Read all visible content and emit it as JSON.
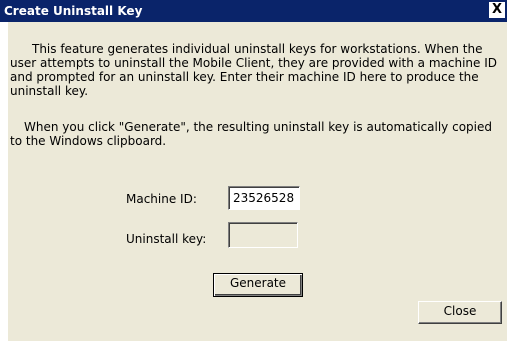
{
  "window": {
    "title": "Create Uninstall Key",
    "close_glyph": "X"
  },
  "description": "This feature generates individual uninstall keys for workstations.  When the user attempts to uninstall the Mobile Client, they are provided with a machine ID and prompted for an uninstall key.  Enter their machine ID here to produce the uninstall key.",
  "note": "When you click \"Generate\", the resulting uninstall key is automatically copied to the Windows clipboard.",
  "form": {
    "machine_id_label": "Machine ID:",
    "machine_id_value": "23526528",
    "uninstall_key_label": "Uninstall key:",
    "uninstall_key_value": ""
  },
  "buttons": {
    "generate_label": "Generate",
    "close_label": "Close"
  },
  "colors": {
    "titlebar": "#0a246a",
    "dialog_face": "#ece9d8"
  }
}
